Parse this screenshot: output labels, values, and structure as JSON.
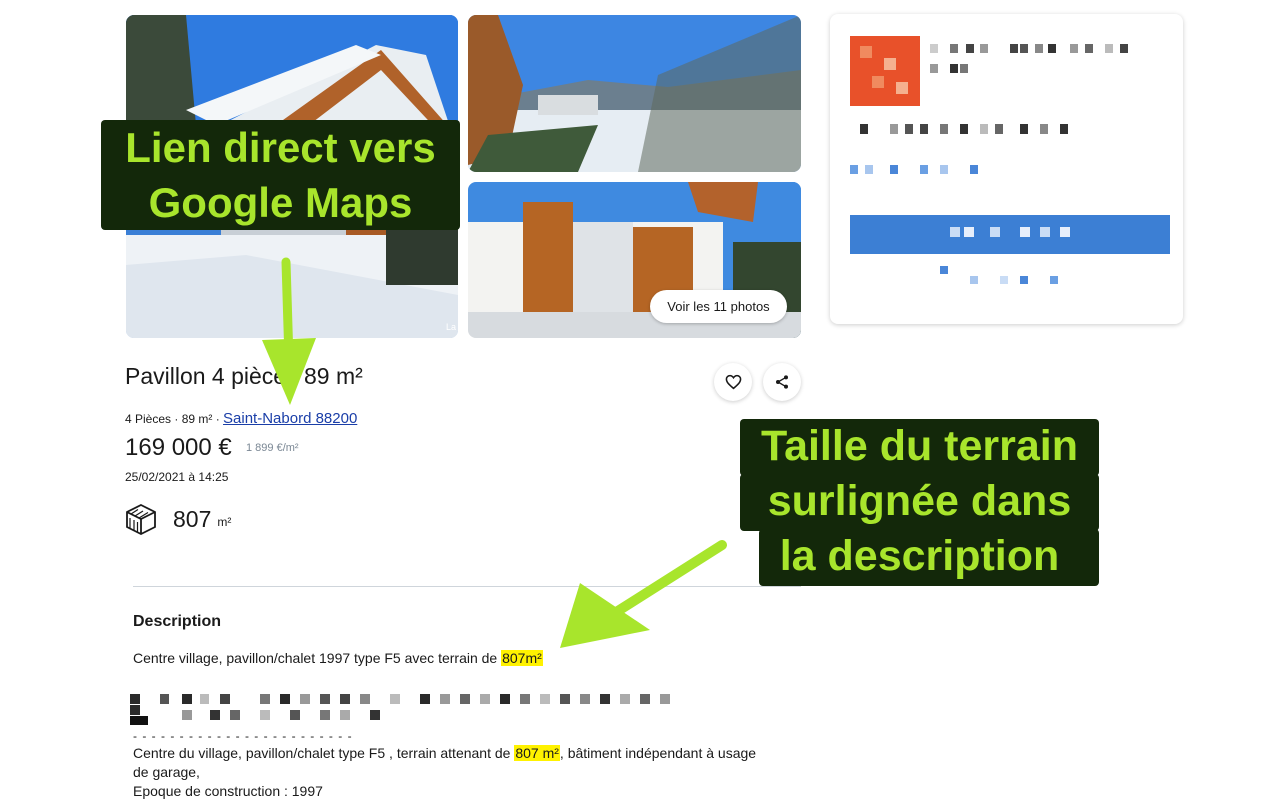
{
  "photos": {
    "view_all_label": "Voir les 11 photos",
    "credit": "La"
  },
  "listing": {
    "title": "Pavillon 4 pièces 89 m²",
    "meta_prefix": "4 Pièces · 89 m² · ",
    "location_link": "Saint-Nabord 88200",
    "price": "169 000 €",
    "price_per_m2": "1 899 €/m²",
    "date": "25/02/2021 à 14:25",
    "land_size": "807",
    "land_unit": "m²"
  },
  "icons": {
    "favorite": "heart-icon",
    "share": "share-icon",
    "land": "land-plot-icon"
  },
  "description": {
    "heading": "Description",
    "line1_prefix": "Centre village, pavillon/chalet 1997 type F5 avec terrain de ",
    "line1_highlight": "807m²",
    "separator": "- - - - - - - - - - - - - - - - - - - - - - - -",
    "line2_prefix": "Centre du village, pavillon/chalet type F5 , terrain attenant de ",
    "line2_highlight": "807 m²",
    "line2_suffix": ", bâtiment indépendant à usage",
    "line3": "de garage,",
    "line4": "Epoque de construction : 1997"
  },
  "annotations": {
    "maps_callout_line1": "Lien direct vers",
    "maps_callout_line2": "Google Maps",
    "terrain_callout_line1": "Taille du terrain",
    "terrain_callout_line2": "surlignée dans",
    "terrain_callout_line3": "la description"
  },
  "colors": {
    "highlight": "#fff200",
    "callout_bg": "#13280a",
    "callout_text": "#a8e52c",
    "arrow": "#a8e52c",
    "link": "#1a3ea8",
    "contact_button": "#3c7fd4",
    "seller_avatar": "#e8512a"
  }
}
